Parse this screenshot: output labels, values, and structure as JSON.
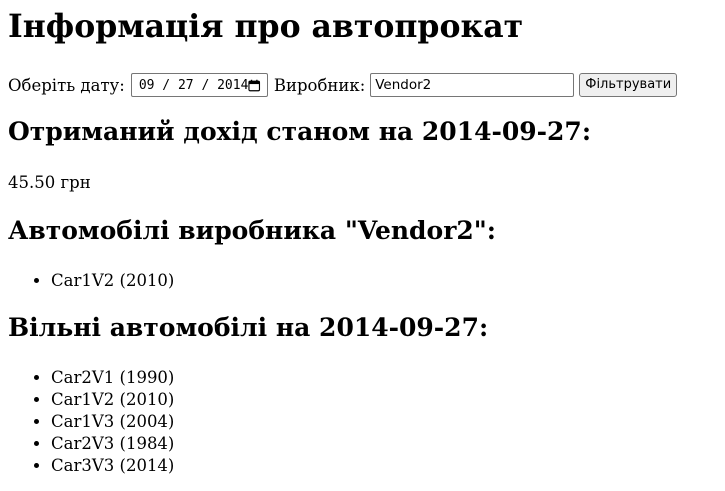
{
  "page_title": "Інформація про автопрокат",
  "filter": {
    "date_label": "Оберіть дату:",
    "date_value": "09 / 27 / 2014",
    "vendor_label": "Виробник:",
    "vendor_value": "Vendor2",
    "button_label": "Фільтрувати"
  },
  "income": {
    "heading": "Отриманий дохід станом на 2014-09-27:",
    "value": "45.50 грн"
  },
  "vendor_cars": {
    "heading": "Автомобілі виробника \"Vendor2\":",
    "items": [
      "Car1V2 (2010)"
    ]
  },
  "free_cars": {
    "heading": "Вільні автомобілі на 2014-09-27:",
    "items": [
      "Car2V1 (1990)",
      "Car1V2 (2010)",
      "Car1V3 (2004)",
      "Car2V3 (1984)",
      "Car3V3 (2014)"
    ]
  },
  "icons": {
    "date_picker": "calendar-icon"
  }
}
